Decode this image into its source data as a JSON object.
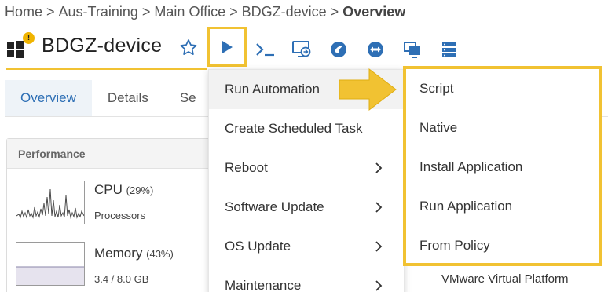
{
  "breadcrumb": {
    "items": [
      "Home",
      "Aus-Training",
      "Main Office",
      "BDGZ-device"
    ],
    "separator": ">",
    "current": "Overview"
  },
  "device": {
    "title": "BDGZ-device",
    "badge": "!",
    "os_icon": "windows-icon"
  },
  "toolbar": {
    "icons": [
      "star-icon",
      "play-icon",
      "terminal-icon",
      "remote-desktop-icon",
      "splashtop-icon",
      "teamviewer-icon",
      "screen-connect-icon",
      "server-stack-icon"
    ]
  },
  "tabs": [
    {
      "label": "Overview",
      "active": true
    },
    {
      "label": "Details",
      "active": false
    },
    {
      "label": "Se",
      "active": false
    }
  ],
  "performance": {
    "header": "Performance",
    "cpu": {
      "name": "CPU",
      "pct": "(29%)",
      "sub": "Processors"
    },
    "memory": {
      "name": "Memory",
      "pct": "(43%)",
      "sub": "3.4 / 8.0 GB"
    }
  },
  "menu": {
    "items": [
      {
        "label": "Run Automation",
        "has_submenu": true,
        "hover": true
      },
      {
        "label": "Create Scheduled Task",
        "has_submenu": false
      },
      {
        "label": "Reboot",
        "has_submenu": true
      },
      {
        "label": "Software Update",
        "has_submenu": true
      },
      {
        "label": "OS Update",
        "has_submenu": true
      },
      {
        "label": "Maintenance",
        "has_submenu": true
      }
    ]
  },
  "submenu": {
    "items": [
      "Script",
      "Native",
      "Install Application",
      "Run Application",
      "From Policy"
    ]
  },
  "background": {
    "vm_platform": "VMware Virtual Platform"
  },
  "colors": {
    "highlight": "#f1c232",
    "accent": "#2e6fb5",
    "play_icon": "#2e6fb5"
  }
}
